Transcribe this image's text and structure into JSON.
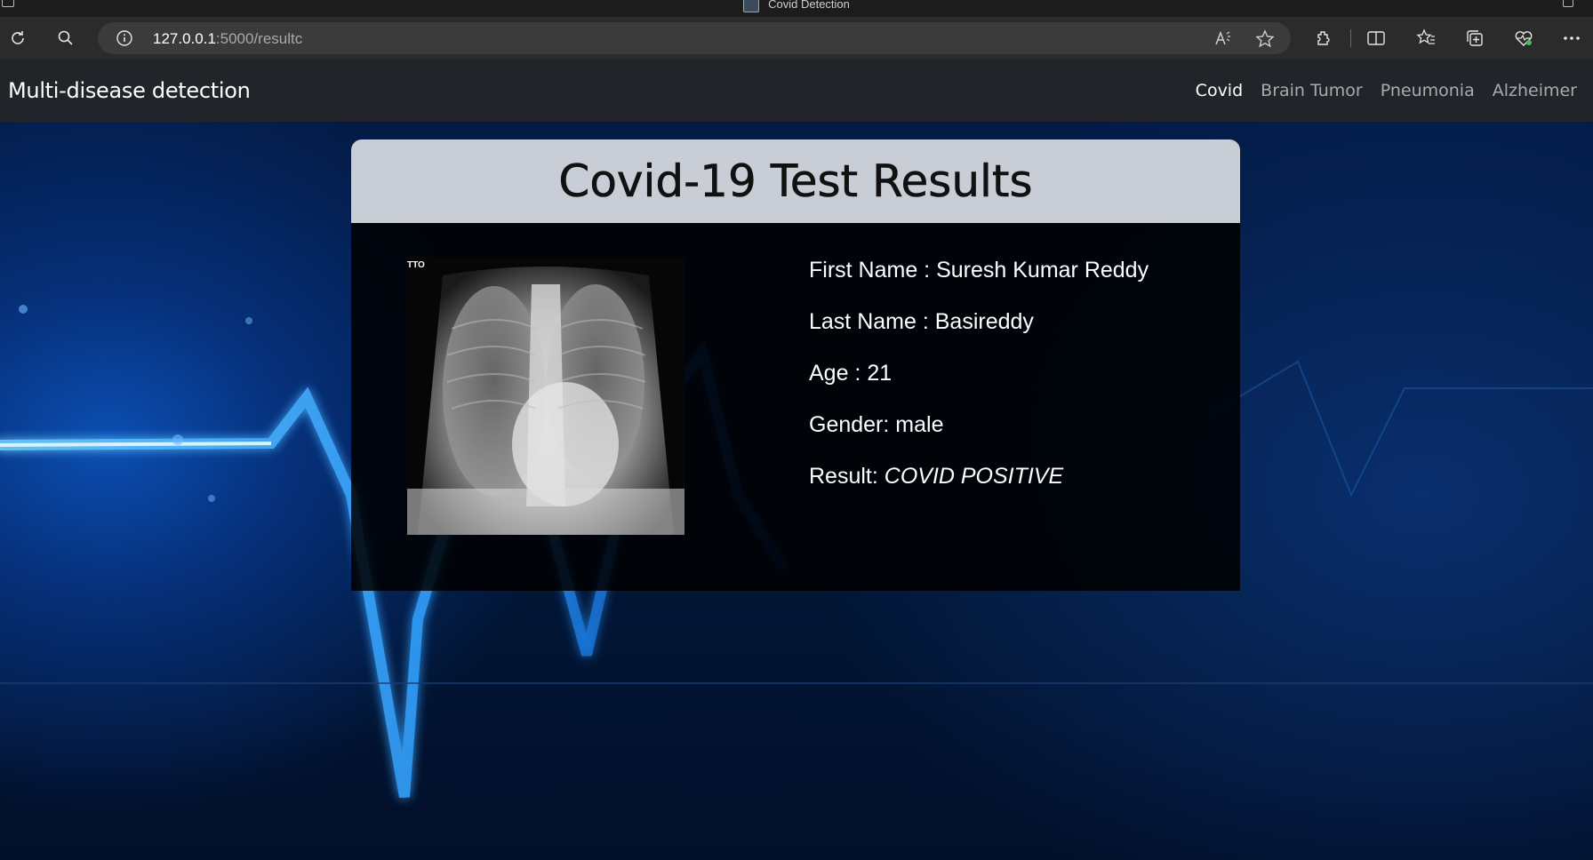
{
  "browser": {
    "tab_title": "Covid Detection",
    "url_host": "127.0.0.1",
    "url_path": ":5000/resultc"
  },
  "navbar": {
    "brand": "Multi-disease detection",
    "links": [
      {
        "label": "Covid",
        "active": true
      },
      {
        "label": "Brain Tumor",
        "active": false
      },
      {
        "label": "Pneumonia",
        "active": false
      },
      {
        "label": "Alzheimer",
        "active": false
      }
    ]
  },
  "card": {
    "title": "Covid-19 Test Results",
    "xray_marker": "TTO",
    "patient": {
      "first_name_label": "First Name : ",
      "first_name": "Suresh Kumar Reddy",
      "last_name_label": "Last Name : ",
      "last_name": "Basireddy",
      "age_label": "Age : ",
      "age": "21",
      "gender_label": "Gender: ",
      "gender": "male",
      "result_label": "Result: ",
      "result": "COVID POSITIVE"
    }
  },
  "colors": {
    "navbar_bg": "#212529",
    "card_header_bg": "#c9ced6",
    "background_accent": "#1e90ff"
  }
}
